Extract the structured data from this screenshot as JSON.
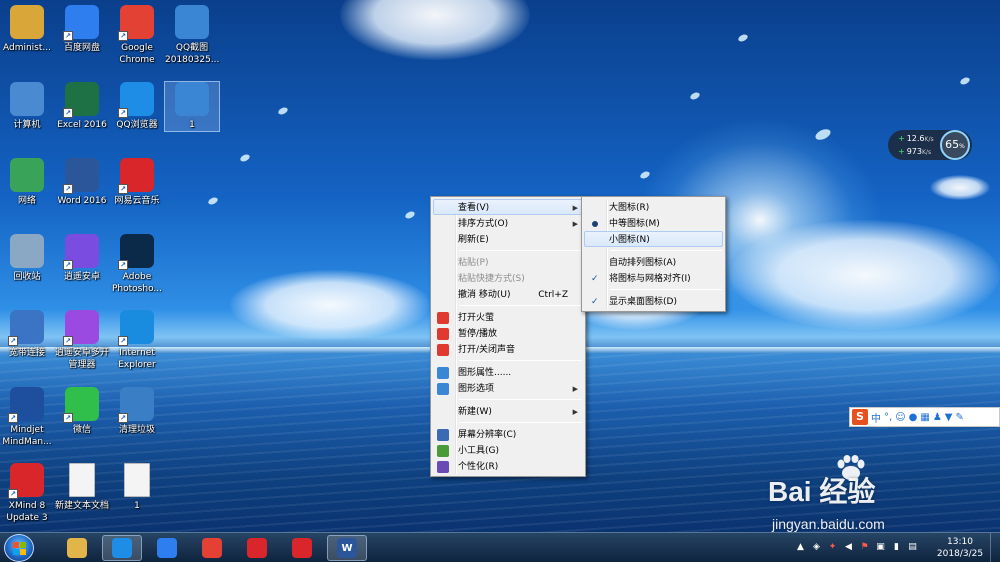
{
  "desktop_icons": [
    {
      "label": "Administ...",
      "icon": "folder-icon",
      "color": "#d9a63a"
    },
    {
      "label": "百度网盘",
      "icon": "baidu-netdisk-icon",
      "color": "#2f7ef0"
    },
    {
      "label": "Google Chrome",
      "icon": "chrome-icon",
      "color": "#e34133"
    },
    {
      "label": "QQ截图 20180325...",
      "icon": "image-file-icon",
      "color": "#3a86d4"
    },
    {
      "label": "计算机",
      "icon": "computer-icon",
      "color": "#4a8ad0"
    },
    {
      "label": "Excel 2016",
      "icon": "excel-icon",
      "color": "#1e7145"
    },
    {
      "label": "QQ浏览器",
      "icon": "qq-browser-icon",
      "color": "#1d8de6"
    },
    {
      "label": "1",
      "icon": "image-file-icon",
      "color": "#3a86d4"
    },
    {
      "label": "网络",
      "icon": "network-icon",
      "color": "#3aa35a"
    },
    {
      "label": "Word 2016",
      "icon": "word-icon",
      "color": "#2b579a"
    },
    {
      "label": "网易云音乐",
      "icon": "netease-music-icon",
      "color": "#d8262b"
    },
    {
      "label": "回收站",
      "icon": "recycle-bin-icon",
      "color": "#8aa8c4"
    },
    {
      "label": "逍遥安卓",
      "icon": "xiaoyao-android-icon",
      "color": "#7a4de0"
    },
    {
      "label": "Adobe Photosho...",
      "icon": "photoshop-icon",
      "color": "#0b2a4a"
    },
    {
      "label": "宽带连接",
      "icon": "broadband-icon",
      "color": "#3b74c4"
    },
    {
      "label": "逍遥安卓多开管理器",
      "icon": "xiaoyao-multi-icon",
      "color": "#9a4ae0"
    },
    {
      "label": "Internet Explorer",
      "icon": "ie-icon",
      "color": "#1a8ce0"
    },
    {
      "label": "Mindjet MindMan...",
      "icon": "mindjet-icon",
      "color": "#1d4f9e"
    },
    {
      "label": "微信",
      "icon": "wechat-icon",
      "color": "#2fbf4a"
    },
    {
      "label": "清理垃圾",
      "icon": "broom-icon",
      "color": "#3a7ec6"
    },
    {
      "label": "XMind 8 Update 3",
      "icon": "xmind-icon",
      "color": "#d8262b"
    },
    {
      "label": "新建文本文档",
      "icon": "text-file-icon",
      "color": "#f4f4f4"
    },
    {
      "label": "1",
      "icon": "text-file-icon",
      "color": "#f4f4f4"
    }
  ],
  "context_menu": {
    "items": [
      {
        "label": "查看(V)",
        "submenu": true,
        "hover": true
      },
      {
        "label": "排序方式(O)",
        "submenu": true
      },
      {
        "label": "刷新(E)"
      },
      {
        "sep": true
      },
      {
        "label": "粘贴(P)",
        "disabled": true
      },
      {
        "label": "粘贴快捷方式(S)",
        "disabled": true
      },
      {
        "label": "撤消 移动(U)",
        "shortcut": "Ctrl+Z"
      },
      {
        "sep": true
      },
      {
        "label": "打开火萤",
        "icon": "firefly-icon",
        "color": "#e03a2f"
      },
      {
        "label": "暂停/播放",
        "icon": "play-icon",
        "color": "#e03a2f"
      },
      {
        "label": "打开/关闭声音",
        "icon": "speaker-icon",
        "color": "#e03a2f"
      },
      {
        "sep": true
      },
      {
        "label": "图形属性......",
        "icon": "graphics-props-icon",
        "color": "#3a86d4"
      },
      {
        "label": "图形选项",
        "icon": "graphics-options-icon",
        "color": "#3a86d4",
        "submenu": true
      },
      {
        "sep": true
      },
      {
        "label": "新建(W)",
        "submenu": true
      },
      {
        "sep": true
      },
      {
        "label": "屏幕分辨率(C)",
        "icon": "screen-res-icon",
        "color": "#3a6ab4"
      },
      {
        "label": "小工具(G)",
        "icon": "gadgets-icon",
        "color": "#4a9a3a"
      },
      {
        "label": "个性化(R)",
        "icon": "personalize-icon",
        "color": "#6a4ab4"
      }
    ]
  },
  "view_submenu": {
    "items": [
      {
        "label": "大图标(R)"
      },
      {
        "label": "中等图标(M)",
        "radio": true
      },
      {
        "label": "小图标(N)",
        "hover": true
      },
      {
        "sep": true
      },
      {
        "label": "自动排列图标(A)"
      },
      {
        "label": "将图标与网格对齐(I)",
        "check": true
      },
      {
        "sep": true
      },
      {
        "label": "显示桌面图标(D)",
        "check": true
      }
    ]
  },
  "net_widget": {
    "up": "12.6",
    "down": "973",
    "unit": "K/s",
    "percent": "65",
    "percent_sign": "%"
  },
  "ime": {
    "logo": "S",
    "mode": "中",
    "punct": "°,"
  },
  "watermark": {
    "brand": "Bai  经验",
    "url": "jingyan.baidu.com"
  },
  "taskbar": {
    "apps": [
      {
        "name": "explorer",
        "icon": "folder-icon",
        "color": "#e2b54a"
      },
      {
        "name": "qq-browser",
        "icon": "qq-browser-icon",
        "color": "#1d8de6",
        "active": true
      },
      {
        "name": "baidu-netdisk",
        "icon": "baidu-netdisk-icon",
        "color": "#2f7ef0"
      },
      {
        "name": "chrome",
        "icon": "chrome-icon",
        "color": "#e34133"
      },
      {
        "name": "netease-music",
        "icon": "netease-music-icon",
        "color": "#d8262b"
      },
      {
        "name": "firefly",
        "icon": "firefly-icon",
        "color": "#d8262b"
      },
      {
        "name": "word",
        "icon": "word-icon",
        "color": "#2b579a",
        "active": true,
        "glyph": "W"
      }
    ],
    "clock_time": "13:10",
    "clock_date": "2018/3/25"
  }
}
